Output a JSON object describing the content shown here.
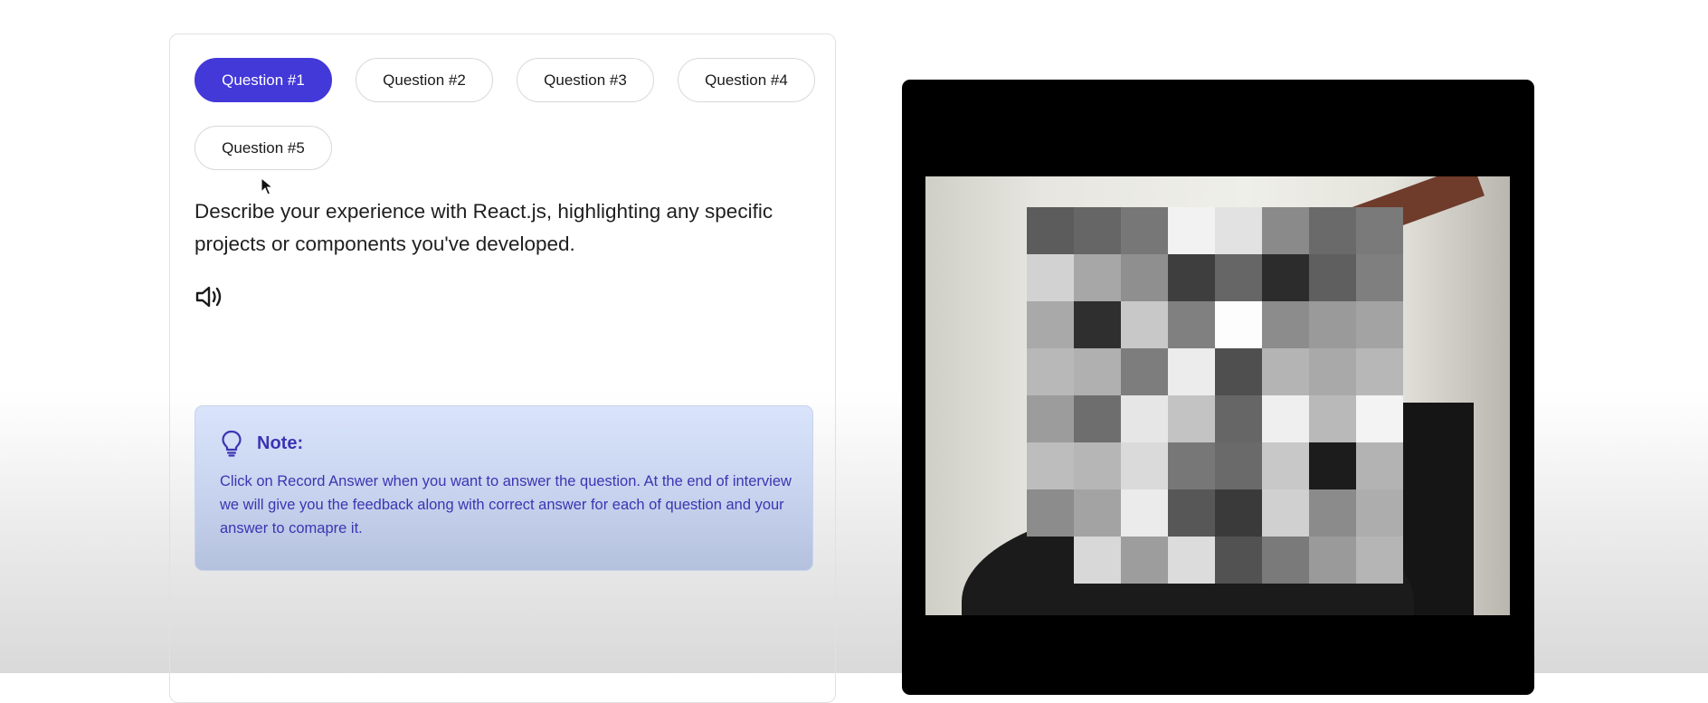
{
  "tabs": [
    {
      "label": "Question #1",
      "active": true
    },
    {
      "label": "Question #2",
      "active": false
    },
    {
      "label": "Question #3",
      "active": false
    },
    {
      "label": "Question #4",
      "active": false
    },
    {
      "label": "Question #5",
      "active": false
    }
  ],
  "question": {
    "text": "Describe your experience with React.js, highlighting any specific projects or components you've developed."
  },
  "note": {
    "title": "Note:",
    "body": "Click on Record Answer when you want to answer the question. At the end of interview we will give you the feedback along with correct answer for each of question and your answer to comapre it."
  },
  "colors": {
    "accent": "#4338d8",
    "note_text": "#3b35b3"
  },
  "icons": [
    "cursor-icon",
    "speaker-icon",
    "lightbulb-icon"
  ]
}
